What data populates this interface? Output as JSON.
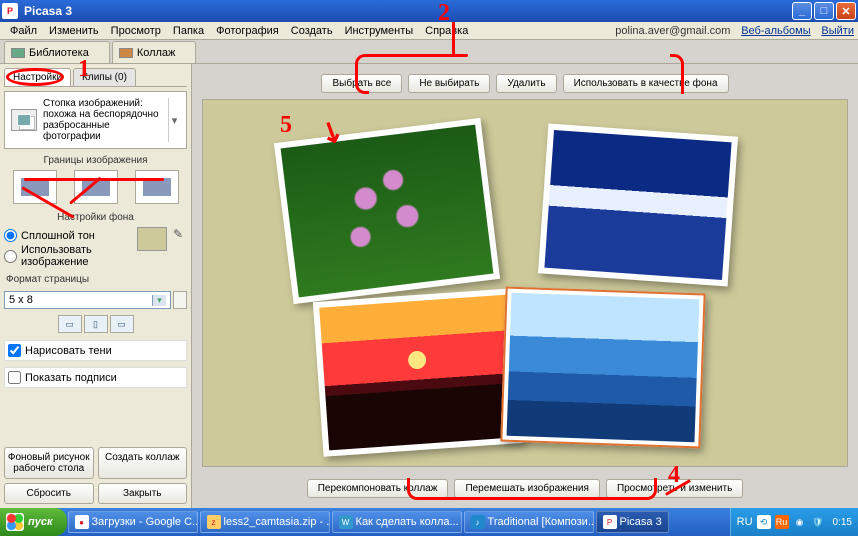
{
  "window": {
    "title": "Picasa 3"
  },
  "menu": {
    "items": [
      "Файл",
      "Изменить",
      "Просмотр",
      "Папка",
      "Фотография",
      "Создать",
      "Инструменты",
      "Справка"
    ],
    "user": "polina.aver@gmail.com",
    "links": {
      "web_albums": "Веб-альбомы",
      "signout": "Выйти"
    }
  },
  "tabs": {
    "library": "Библиотека",
    "collage": "Коллаж"
  },
  "left": {
    "subtabs": {
      "settings": "Настройки",
      "clips": "Клипы (0)"
    },
    "style_desc": "Стопка изображений: похожа на беспорядочно разбросанные фотографии",
    "sec_borders": "Границы изображения",
    "sec_bg": "Настройки фона",
    "radio_solid": "Сплошной тон",
    "radio_image": "Использовать изображение",
    "sec_page": "Формат страницы",
    "page_value": "5 x 8",
    "chk_shadows": "Нарисовать тени",
    "chk_captions": "Показать подписи",
    "btn_wallpaper": "Фоновый рисунок рабочего стола",
    "btn_create": "Создать коллаж",
    "btn_reset": "Сбросить",
    "btn_close": "Закрыть"
  },
  "topbar": {
    "select_all": "Выбрать все",
    "select_none": "Не выбирать",
    "delete": "Удалить",
    "use_as_bg": "Использовать в качестве фона"
  },
  "bottombar": {
    "recompose": "Перекомпоновать коллаж",
    "shuffle": "Перемешать изображения",
    "preview": "Просмотреть и изменить"
  },
  "taskbar": {
    "start": "пуск",
    "items": [
      "Загрузки - Google C...",
      "less2_camtasia.zip - ...",
      "Как сделать колла...",
      "Traditional [Компози...",
      "Picasa 3"
    ],
    "lang": "RU",
    "clock": "0:15"
  },
  "annotations": {
    "n1": "1",
    "n2": "2",
    "n4": "4",
    "n5": "5"
  }
}
